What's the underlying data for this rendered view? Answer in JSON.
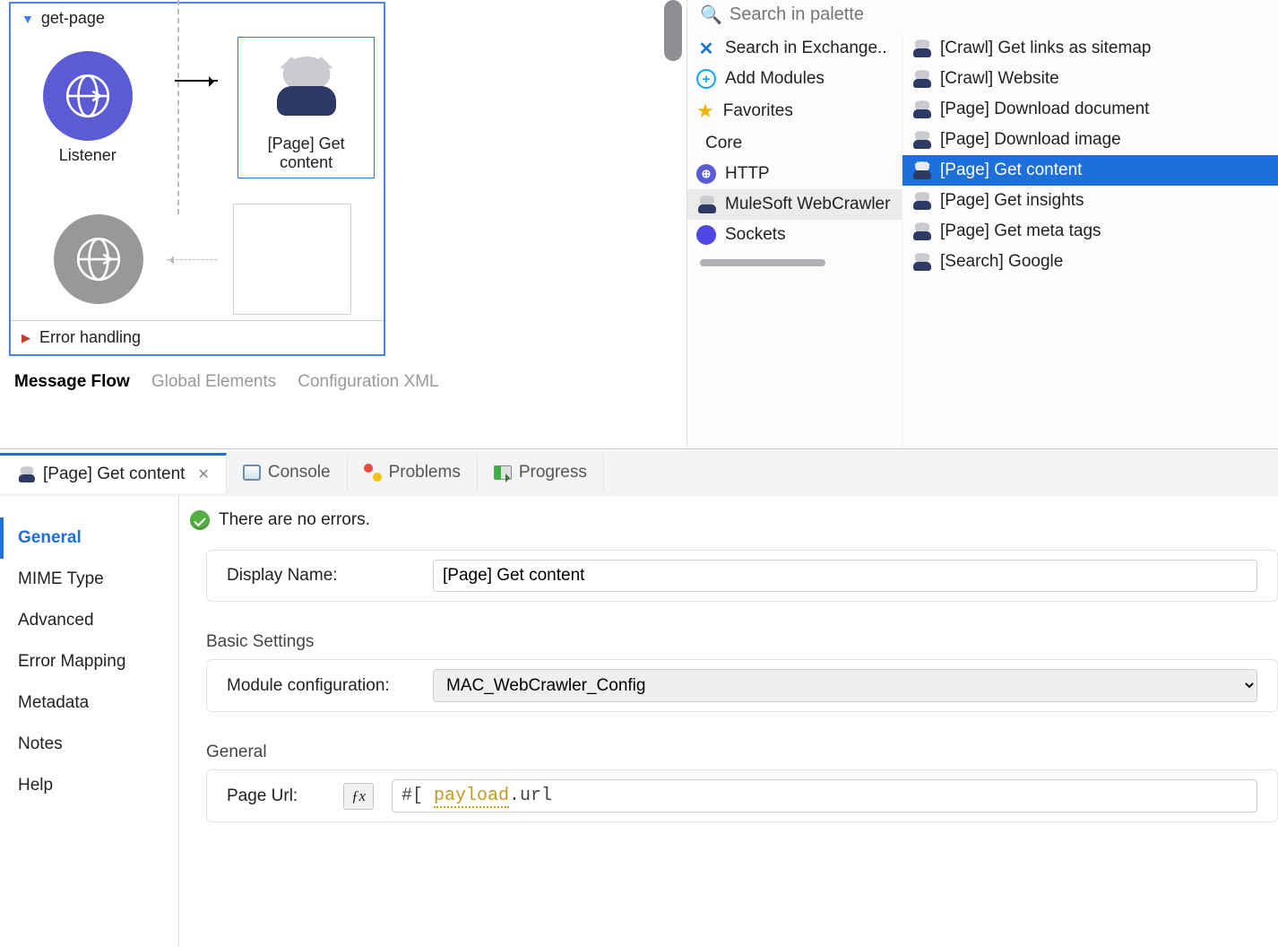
{
  "flow": {
    "name": "get-page",
    "listener_label": "Listener",
    "get_content_label": "[Page] Get content",
    "error_label": "Error handling"
  },
  "editor_tabs": {
    "message_flow": "Message Flow",
    "global_elements": "Global Elements",
    "config_xml": "Configuration XML"
  },
  "palette": {
    "search_placeholder": "Search in palette",
    "categories": [
      {
        "label": "Search in Exchange..",
        "icon": "exchange"
      },
      {
        "label": "Add Modules",
        "icon": "plus"
      },
      {
        "label": "Favorites",
        "icon": "star"
      },
      {
        "label": "Core",
        "icon": "core"
      },
      {
        "label": "HTTP",
        "icon": "http"
      },
      {
        "label": "MuleSoft WebCrawler",
        "icon": "cat",
        "selected": true
      },
      {
        "label": "Sockets",
        "icon": "sockets"
      }
    ],
    "operations": [
      {
        "label": "[Crawl] Get links as sitemap"
      },
      {
        "label": "[Crawl] Website"
      },
      {
        "label": "[Page] Download document"
      },
      {
        "label": "[Page] Download image"
      },
      {
        "label": "[Page] Get content",
        "selected": true
      },
      {
        "label": "[Page] Get insights"
      },
      {
        "label": "[Page] Get meta tags"
      },
      {
        "label": "[Search] Google"
      }
    ]
  },
  "bottom": {
    "active_tab": "[Page] Get content",
    "tabs": {
      "console": "Console",
      "problems": "Problems",
      "progress": "Progress"
    },
    "sidebar": {
      "general": "General",
      "mime": "MIME Type",
      "advanced": "Advanced",
      "error_mapping": "Error Mapping",
      "metadata": "Metadata",
      "notes": "Notes",
      "help": "Help"
    },
    "status": "There are no errors.",
    "display_name_label": "Display Name:",
    "display_name_value": "[Page] Get content",
    "basic_settings": "Basic Settings",
    "module_config_label": "Module configuration:",
    "module_config_value": "MAC_WebCrawler_Config",
    "general_section": "General",
    "page_url_label": "Page Url:",
    "expr_prefix": "#[ ",
    "expr_payload": "payload",
    "expr_dot": ".",
    "expr_url": "url"
  }
}
